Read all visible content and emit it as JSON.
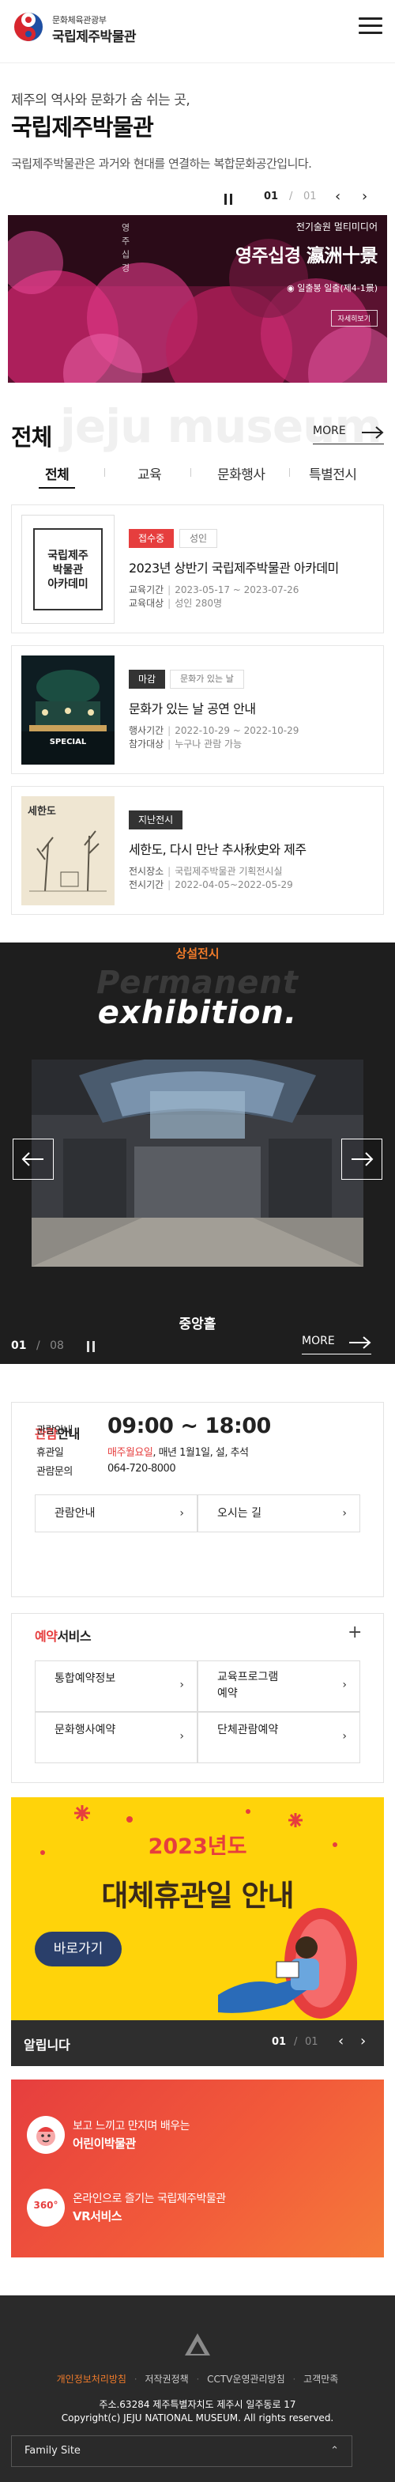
{
  "header": {
    "ministry": "문화체육관광부",
    "museum_name": "국립제주박물관"
  },
  "hero": {
    "subtitle": "제주의 역사와 문화가 숨 쉬는 곳,",
    "title": "국립제주박물관",
    "description": "국립제주박물관은 과거와 현대를 연결하는 복합문화공간입니다.",
    "slide_current": "01",
    "slide_sep": "/",
    "slide_total": "01"
  },
  "banner": {
    "subtitle": "전기술원 멀티미디어",
    "title": "영주십경 瀛洲十景",
    "location": "일출봉 일출(제4-1景)",
    "vertical_text": "영주십경",
    "button": "자세히보기"
  },
  "programs": {
    "watermark": "jeju museum",
    "heading": "전체",
    "more": "MORE",
    "tabs": [
      "전체",
      "교육",
      "문화행사",
      "특별전시"
    ],
    "cards": [
      {
        "badge1": "접수중",
        "badge2": "성인",
        "thumb_text": "국립제주\n박물관\n아카데미",
        "title": "2023년 상반기 국립제주박물관 아카데미",
        "row1_label": "교육기간",
        "row1_value": "2023-05-17 ~ 2023-07-26",
        "row2_label": "교육대상",
        "row2_value": "성인 280명"
      },
      {
        "badge1": "마감",
        "badge2": "문화가 있는 날",
        "thumb_text": "SPECIAL",
        "title": "문화가 있는 날 공연 안내",
        "row1_label": "행사기간",
        "row1_value": "2022-10-29 ~ 2022-10-29",
        "row2_label": "참가대상",
        "row2_value": "누구나 관람 가능"
      },
      {
        "badge1": "지난전시",
        "thumb_text": "세한도",
        "title": "세한도, 다시 만난 추사秋史와 제주",
        "row1_label": "전시장소",
        "row1_value": "국립제주박물관 기획전시실",
        "row2_label": "전시기간",
        "row2_value": "2022-04-05~2022-05-29"
      }
    ]
  },
  "exhibition": {
    "label": "상설전시",
    "en_line1": "Permanent",
    "en_line2": "exhibition.",
    "hall_name": "중앙홀",
    "count_current": "01",
    "count_sep": "/",
    "count_total": "08",
    "more": "MORE"
  },
  "visit": {
    "title_accent": "관람",
    "title_rest": "안내",
    "hours_label": "관람안내",
    "hours_value": "09:00 ~ 18:00",
    "closed_label": "휴관일",
    "closed_accent": "매주월요일",
    "closed_rest": ", 매년 1월1일, 설, 추석",
    "tel_label": "관람문의",
    "tel_value": "064-720-8000",
    "btn_guide": "관람안내",
    "btn_directions": "오시는 길"
  },
  "reservation": {
    "title_accent": "예약",
    "title_rest": "서비스",
    "plus": "+",
    "buttons": [
      "통합예약정보",
      "교육프로그램\n예약",
      "문화행사예약",
      "단체관람예약"
    ]
  },
  "promo": {
    "year_line": "2023년도",
    "headline": "대체휴관일 안내",
    "button": "바로가기"
  },
  "notice": {
    "title": "알립니다",
    "current": "01",
    "sep": "/",
    "total": "01"
  },
  "quick": [
    {
      "line1": "보고 느끼고 만지며 배우는",
      "line2": "어린이박물관",
      "icon": "child-icon"
    },
    {
      "line1": "온라인으로 즐기는 국립제주박물관",
      "line2": "VR서비스",
      "icon": "vr-360-icon",
      "icon_text": "360°"
    }
  ],
  "footer": {
    "links": [
      "개인정보처리방침",
      "저작권정책",
      "CCTV운영관리방침",
      "고객만족"
    ],
    "address": "주소.63284 제주특별자치도 제주시 일주동로 17",
    "copyright": "Copyright(c) JEJU NATIONAL MUSEUM. All rights reserved.",
    "family_site": "Family Site"
  },
  "colors": {
    "accent": "#e63e3e",
    "orange": "#f07b2a",
    "dark": "#2e2e2e",
    "yellow": "#ffd30a"
  }
}
